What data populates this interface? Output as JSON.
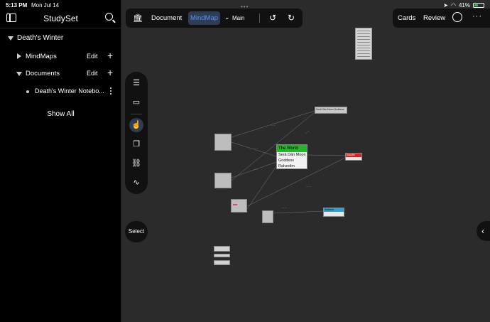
{
  "status_bar": {
    "time": "5:13 PM",
    "date": "Mon Jul 14",
    "battery": "41%",
    "battery_fraction": 0.41
  },
  "sidebar": {
    "title": "StudySet",
    "set_name": "Death's Winter",
    "mindmaps": {
      "label": "MindMaps",
      "edit": "Edit",
      "add": "+"
    },
    "documents": {
      "label": "Documents",
      "edit": "Edit",
      "add": "+"
    },
    "document_item": "Death's Winter Notebo...",
    "show_all": "Show All"
  },
  "toolbar": {
    "document_tab": "Document",
    "mindmap_tab": "MindMap",
    "branch": "Main"
  },
  "right_toolbar": {
    "cards": "Cards",
    "review": "Review",
    "more": "···"
  },
  "tools": {
    "list": "list-icon",
    "layout": "layout-icon",
    "pointer": "hand-pointer-icon",
    "copy": "copy-icon",
    "link": "link-icon",
    "draw": "draw-icon"
  },
  "select_button": "Select",
  "mindmap": {
    "center_title": "The World",
    "center_lines": [
      "Serā Dān Moon",
      "Goddess",
      "Rahzelim"
    ],
    "center_color": "#27b52c",
    "top_node": "Serā Dān Moon Goddess",
    "red_node": "Kaustin",
    "red_color": "#d62424",
    "blue_color": "#2ea0d6",
    "blue_node": "Sorbeck"
  }
}
